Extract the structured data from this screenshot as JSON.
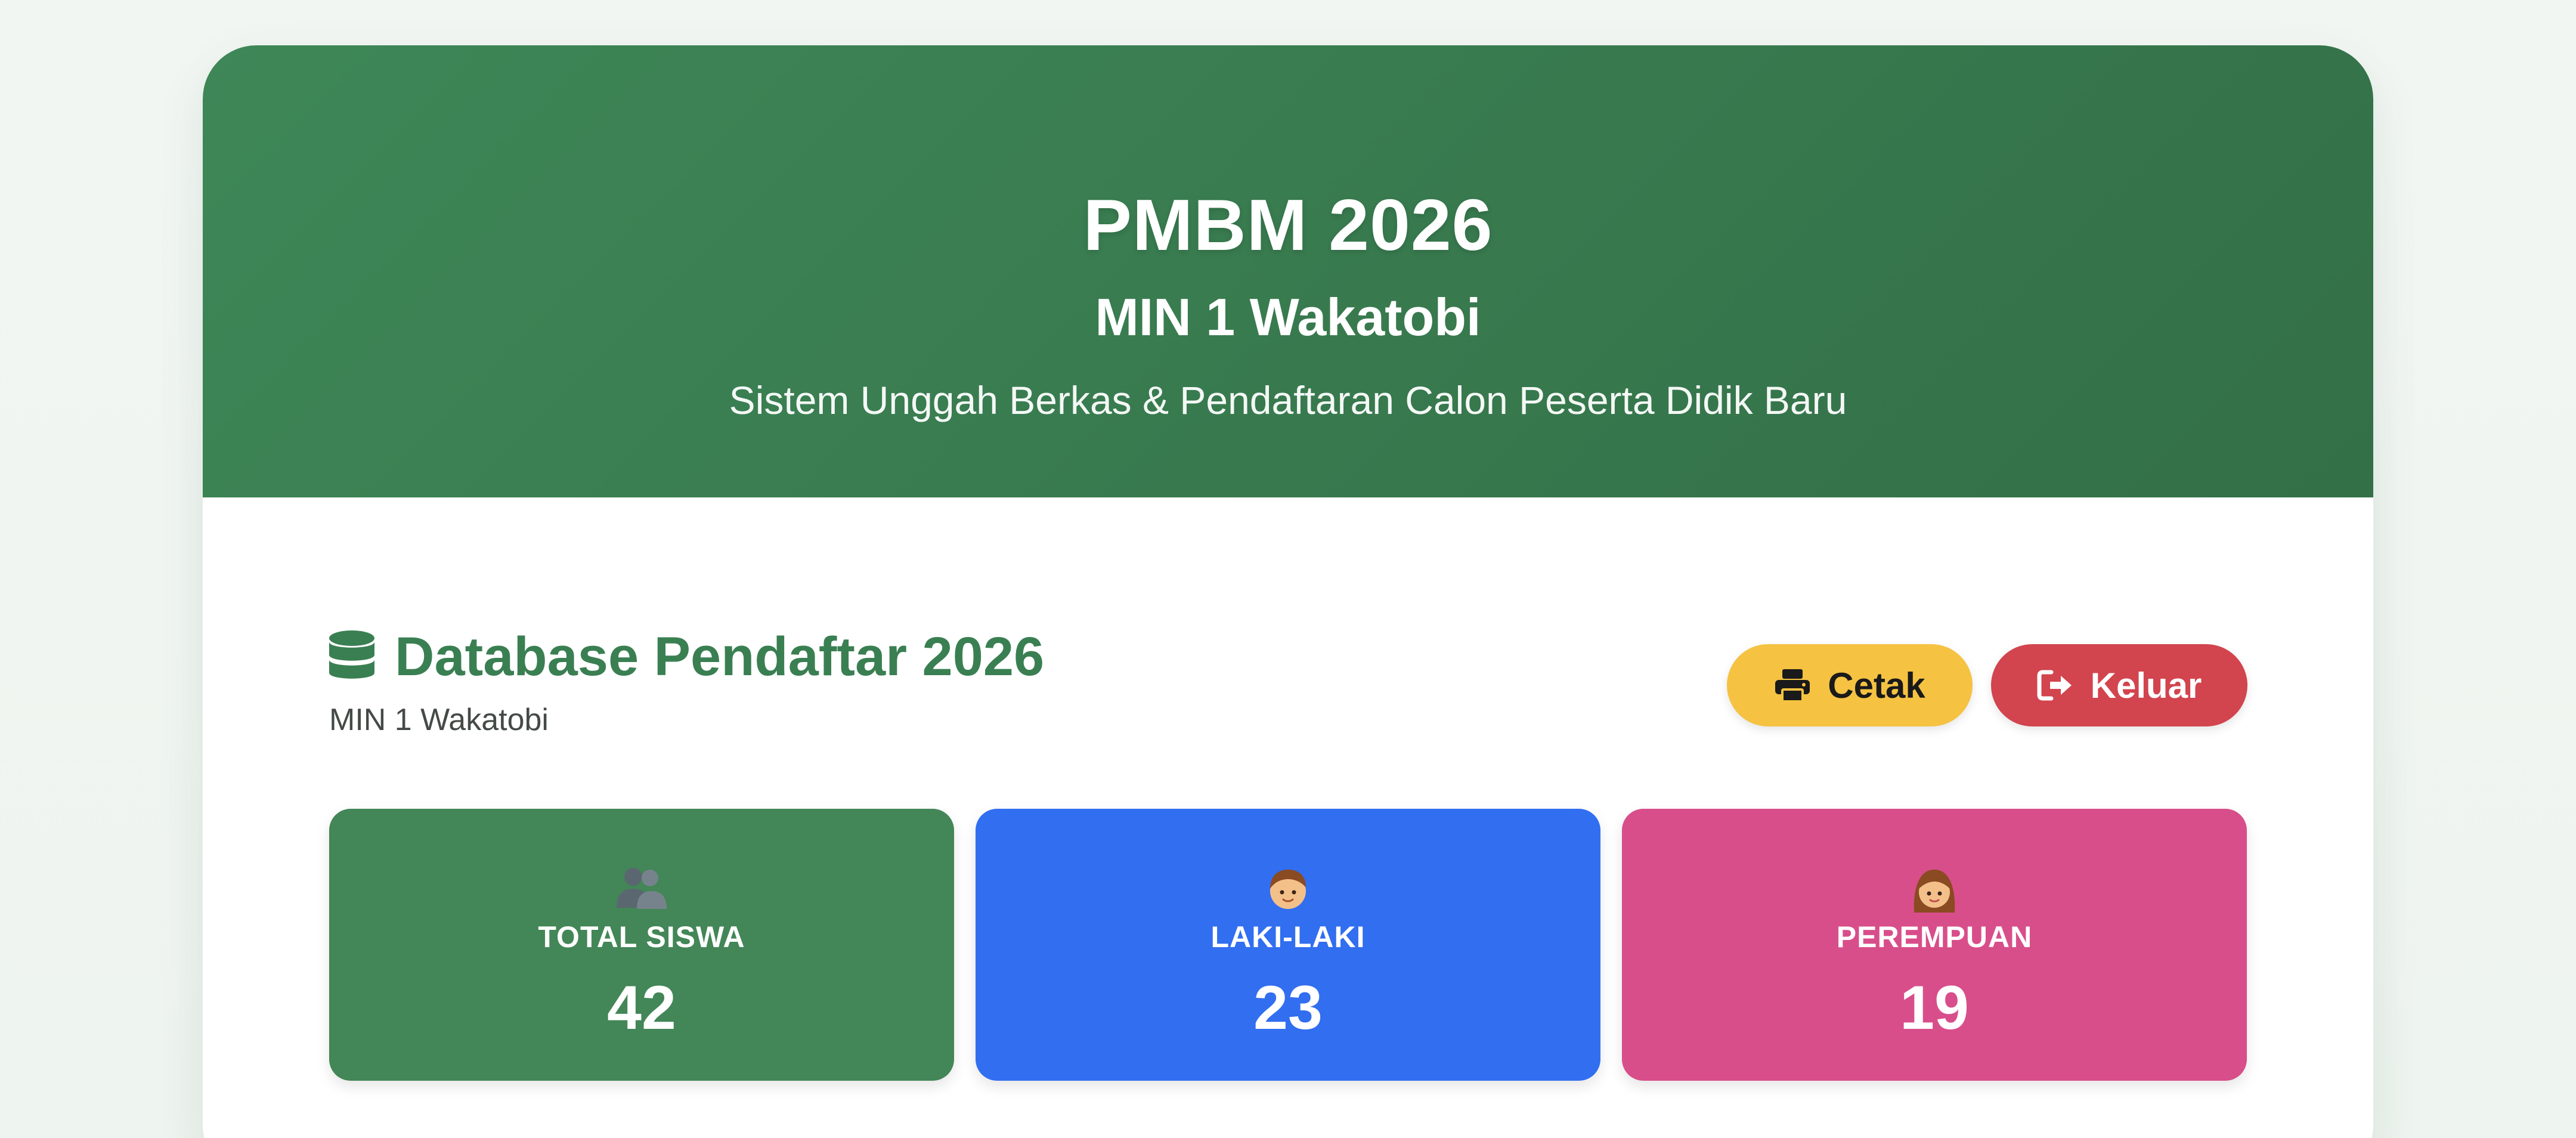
{
  "header": {
    "title": "PMBM 2026",
    "school": "MIN 1 Wakatobi",
    "description": "Sistem Unggah Berkas & Pendaftaran Calon Peserta Didik Baru"
  },
  "dashboard": {
    "title": "Database Pendaftar 2026",
    "subtitle": "MIN 1 Wakatobi",
    "icon": "database-icon",
    "actions": {
      "print_label": "Cetak",
      "logout_label": "Keluar"
    }
  },
  "stats": [
    {
      "label": "TOTAL SISWA",
      "value": "42",
      "icon": "users-icon",
      "color": "#438657"
    },
    {
      "label": "LAKI-LAKI",
      "value": "23",
      "icon": "boy-icon",
      "color": "#316ef0"
    },
    {
      "label": "PEREMPUAN",
      "value": "19",
      "icon": "girl-icon",
      "color": "#d84e8a"
    }
  ],
  "colors": {
    "primary": "#3a7f52",
    "print_button": "#f5c242",
    "logout_button": "#d2444e"
  }
}
